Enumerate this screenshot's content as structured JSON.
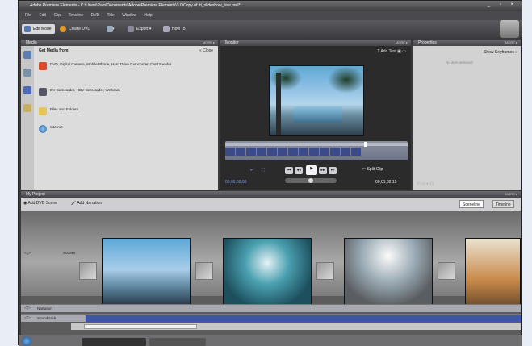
{
  "window": {
    "title": "Adobe Premiere Elements - C:\\Users\\Pam\\Documents\\Adobe\\Premiere Elements\\3.0\\Copy of ttt_slideshow_tour.prel*",
    "controls": "_ ▫ ×"
  },
  "menu": [
    "File",
    "Edit",
    "Clip",
    "Timeline",
    "DVD",
    "Title",
    "Window",
    "Help"
  ],
  "toolbar": {
    "edit_mode": "Edit Mode",
    "create_dvd": "Create DVD",
    "export": "Export ▾",
    "how_to": "How To"
  },
  "media": {
    "title": "Media",
    "more": "MORE ▸",
    "get_media_from": "Get Media from:",
    "close": "« Close",
    "items": [
      {
        "label": "DVD, Digital Camera, Mobile Phone, Hard Drive Camcorder, Card Reader",
        "icon": "camera-icon"
      },
      {
        "label": "DV Camcorder, HDV Camcorder, Webcam",
        "icon": "camcorder-icon"
      },
      {
        "label": "Files and Folders",
        "icon": "folder-icon"
      },
      {
        "label": "Internet",
        "icon": "globe-icon"
      }
    ]
  },
  "monitor": {
    "title": "Monitor",
    "more": "MORE ▸",
    "add_text": "Add Text",
    "timecode_start": "00;00;00;00",
    "timecode_end": "00;01;02;15",
    "split_clip": "Split Clip"
  },
  "properties": {
    "title": "Properties",
    "more": "MORE ▸",
    "show_keyframes": "Show Keyframes »",
    "no_item": "No item selected"
  },
  "project": {
    "title": "My Project",
    "more": "MORE ▸",
    "add_dvd_scene": "Add DVD Scene",
    "add_narration": "Add Narration",
    "sceneline": "Sceneline",
    "timeline": "Timeline",
    "tracks": {
      "scenes": "Scenes",
      "narration": "Narration",
      "soundtrack": "Soundtrack"
    }
  },
  "colors": {
    "accent": "#3c4a88",
    "scene_blue": "#4a74c8"
  }
}
